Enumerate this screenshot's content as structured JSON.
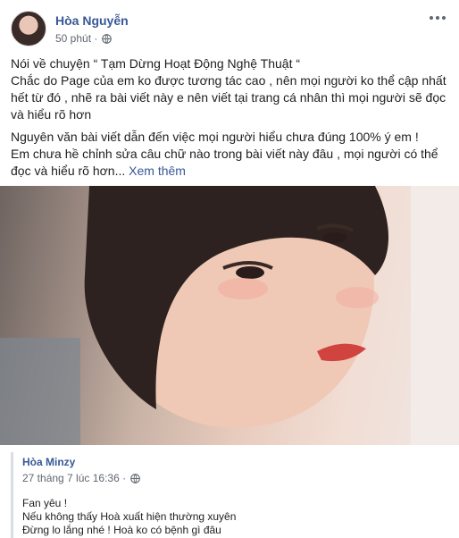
{
  "post": {
    "author": "Hòa Nguyễn",
    "time": "50 phút ·",
    "body": [
      "Nói về chuyện “ Tạm Dừng Hoạt Động Nghệ Thuật “\nChắc do Page của em ko được tương tác cao , nên mọi người ko thể cập nhất hết từ đó , nhẽ ra bài viết này e nên viết tại trang cá nhân thì mọi người sẽ đọc và hiểu rõ hơn",
      "Nguyên văn bài viết dẫn đến việc mọi người hiểu chưa đúng 100% ý em !\nEm chưa hề chỉnh sửa câu chữ nào trong bài viết này đâu , mọi người có thể đọc và hiểu rõ hơn... "
    ],
    "see_more": "Xem thêm"
  },
  "shared": {
    "author": "Hòa Minzy",
    "time": "27 tháng 7 lúc 16:36 ·",
    "lines": [
      "Fan yêu !",
      "Nếu không thấy Hoà xuất hiện thường xuyên",
      "Đừng lo lắng nhé ! Hoà ko có bệnh gì đâu"
    ]
  },
  "icons": {
    "privacy": "globe-icon",
    "menu": "more-options-icon"
  },
  "colors": {
    "link": "#385898",
    "meta": "#606770",
    "text": "#1c1e21"
  }
}
